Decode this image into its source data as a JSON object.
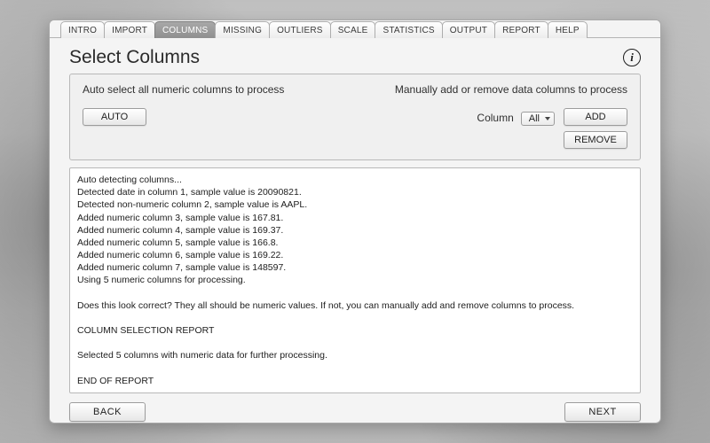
{
  "tabs": {
    "items": [
      "INTRO",
      "IMPORT",
      "COLUMNS",
      "MISSING",
      "OUTLIERS",
      "SCALE",
      "STATISTICS",
      "OUTPUT",
      "REPORT",
      "HELP"
    ],
    "active_index": 2
  },
  "title": "Select Columns",
  "info_glyph": "i",
  "panel": {
    "auto_hint": "Auto select all numeric columns to process",
    "manual_hint": "Manually add or remove data columns to process",
    "auto_button": "AUTO",
    "column_label": "Column",
    "column_select_value": "All",
    "add_button": "ADD",
    "remove_button": "REMOVE"
  },
  "log_lines": [
    "Auto detecting columns...",
    "Detected date in column 1, sample value is 20090821.",
    "Detected non-numeric column 2, sample value is AAPL.",
    "Added numeric column 3, sample value is 167.81.",
    "Added numeric column 4, sample value is 169.37.",
    "Added numeric column 5, sample value is 166.8.",
    "Added numeric column 6, sample value is 169.22.",
    "Added numeric column 7, sample value is 148597.",
    "Using 5 numeric columns for processing.",
    "",
    "Does this look correct? They all should be numeric values. If not, you can manually add and remove columns to process.",
    "",
    "COLUMN SELECTION REPORT",
    "",
    "Selected 5 columns with numeric data for further processing.",
    "",
    "END OF REPORT"
  ],
  "footer": {
    "back": "BACK",
    "next": "NEXT"
  }
}
